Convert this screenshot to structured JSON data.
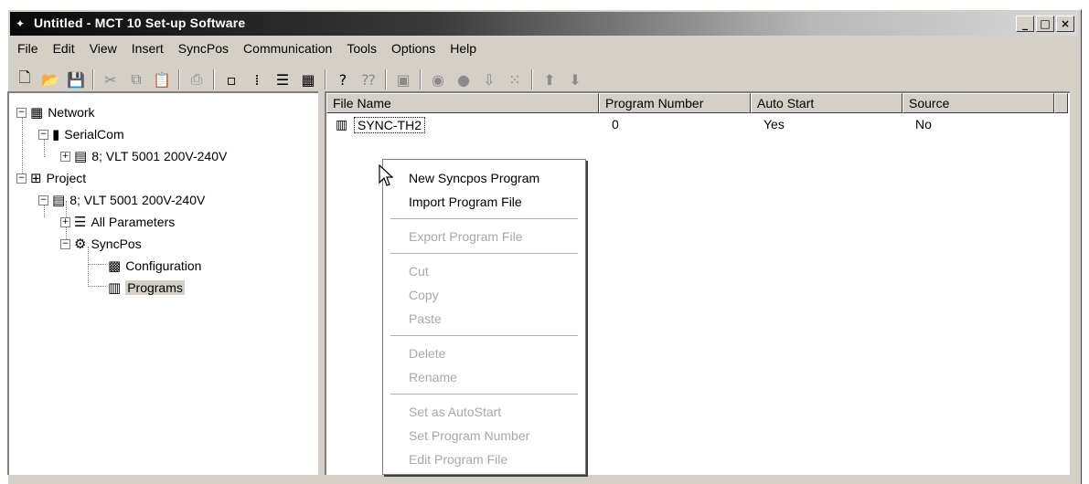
{
  "window": {
    "title": "Untitled - MCT 10 Set-up Software",
    "title_icon": "app-icon",
    "buttons": [
      "_",
      "□",
      "×"
    ]
  },
  "menu": [
    "File",
    "Edit",
    "View",
    "Insert",
    "SyncPos",
    "Communication",
    "Tools",
    "Options",
    "Help"
  ],
  "toolbar": [
    {
      "icon": "new-file-icon",
      "glyph": "🗋"
    },
    {
      "icon": "open-folder-icon",
      "glyph": "📂"
    },
    {
      "icon": "save-icon",
      "glyph": "💾"
    },
    {
      "sep": true
    },
    {
      "icon": "cut-icon",
      "glyph": "✂",
      "disabled": true
    },
    {
      "icon": "copy-icon",
      "glyph": "⧉",
      "disabled": true
    },
    {
      "icon": "paste-icon",
      "glyph": "📋",
      "disabled": true
    },
    {
      "sep": true
    },
    {
      "icon": "print-icon",
      "glyph": "⎙",
      "disabled": true
    },
    {
      "sep": true
    },
    {
      "icon": "large-icons-icon",
      "glyph": "▫"
    },
    {
      "icon": "small-icons-icon",
      "glyph": "⁞"
    },
    {
      "icon": "list-view-icon",
      "glyph": "☰"
    },
    {
      "icon": "details-view-icon",
      "glyph": "▦"
    },
    {
      "sep": true
    },
    {
      "icon": "help-icon",
      "glyph": "?"
    },
    {
      "icon": "context-help-icon",
      "glyph": "⁇",
      "disabled": true
    },
    {
      "sep": true
    },
    {
      "icon": "device-icon",
      "glyph": "▣",
      "disabled": true
    },
    {
      "sep": true
    },
    {
      "icon": "connect-icon",
      "glyph": "◉",
      "disabled": true
    },
    {
      "icon": "stop-icon",
      "glyph": "●",
      "disabled": true
    },
    {
      "icon": "download-icon",
      "glyph": "⇩",
      "disabled": true
    },
    {
      "icon": "upload-icon",
      "glyph": "⁙",
      "disabled": true
    },
    {
      "sep": true
    },
    {
      "icon": "move-up-icon",
      "glyph": "⬆",
      "disabled": true
    },
    {
      "icon": "move-down-icon",
      "glyph": "⬇",
      "disabled": true
    }
  ],
  "tree": {
    "network": {
      "label": "Network",
      "expander": "−"
    },
    "serialcom": {
      "label": "SerialCom",
      "expander": "−"
    },
    "network_device": {
      "label": "8; VLT 5001 200V-240V",
      "expander": "+"
    },
    "project": {
      "label": "Project",
      "expander": "−"
    },
    "project_device": {
      "label": "8; VLT 5001 200V-240V",
      "expander": "−"
    },
    "all_parameters": {
      "label": "All Parameters",
      "expander": "+"
    },
    "syncpos": {
      "label": "SyncPos",
      "expander": "−"
    },
    "configuration": {
      "label": "Configuration"
    },
    "programs": {
      "label": "Programs"
    }
  },
  "table": {
    "columns": [
      "File Name",
      "Program Number",
      "Auto Start",
      "Source"
    ],
    "rows": [
      {
        "file_name": "SYNC-TH2",
        "program_number": "0",
        "auto_start": "Yes",
        "source": "No"
      }
    ]
  },
  "context_menu": {
    "new_program": "New Syncpos Program",
    "import_file": "Import Program File",
    "export_file": "Export Program File",
    "cut": "Cut",
    "copy": "Copy",
    "paste": "Paste",
    "delete": "Delete",
    "rename": "Rename",
    "set_autostart": "Set as AutoStart",
    "set_number": "Set Program Number",
    "edit_file": "Edit Program File"
  }
}
